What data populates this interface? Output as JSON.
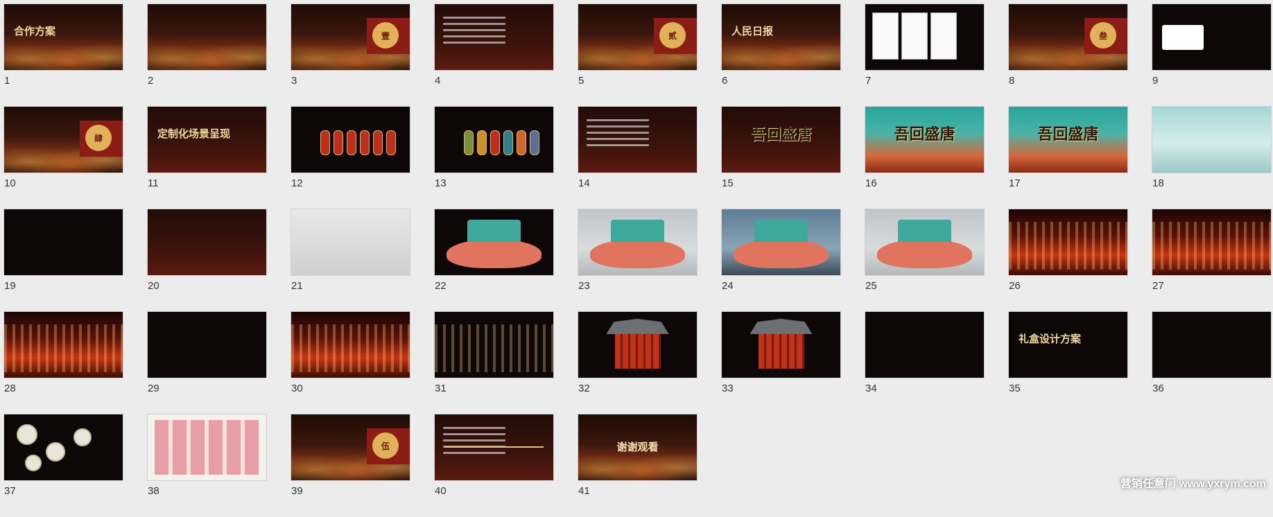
{
  "slides": [
    {
      "number": "1",
      "theme": "dark",
      "title": "合作方案"
    },
    {
      "number": "2",
      "theme": "dark",
      "title": ""
    },
    {
      "number": "3",
      "theme": "dark",
      "badge": "壹"
    },
    {
      "number": "4",
      "theme": "red",
      "title": ""
    },
    {
      "number": "5",
      "theme": "dark",
      "badge": "贰"
    },
    {
      "number": "6",
      "theme": "dark",
      "title": "人民日报"
    },
    {
      "number": "7",
      "theme": "black",
      "title": ""
    },
    {
      "number": "8",
      "theme": "dark",
      "badge": "叁"
    },
    {
      "number": "9",
      "theme": "black",
      "title": ""
    },
    {
      "number": "10",
      "theme": "dark",
      "badge": "肆"
    },
    {
      "number": "11",
      "theme": "red",
      "title": "定制化场景呈现"
    },
    {
      "number": "12",
      "theme": "black",
      "title": ""
    },
    {
      "number": "13",
      "theme": "black",
      "title": ""
    },
    {
      "number": "14",
      "theme": "red",
      "title": ""
    },
    {
      "number": "15",
      "theme": "red",
      "title": "吾回盛唐"
    },
    {
      "number": "16",
      "theme": "poster",
      "title": "吾回盛唐"
    },
    {
      "number": "17",
      "theme": "poster",
      "title": "吾回盛唐"
    },
    {
      "number": "18",
      "theme": "teal",
      "title": ""
    },
    {
      "number": "19",
      "theme": "black",
      "title": ""
    },
    {
      "number": "20",
      "theme": "red",
      "title": ""
    },
    {
      "number": "21",
      "theme": "light",
      "title": ""
    },
    {
      "number": "22",
      "theme": "black",
      "title": ""
    },
    {
      "number": "23",
      "theme": "stage",
      "title": ""
    },
    {
      "number": "24",
      "theme": "sky",
      "title": ""
    },
    {
      "number": "25",
      "theme": "stage",
      "title": ""
    },
    {
      "number": "26",
      "theme": "lantern",
      "title": ""
    },
    {
      "number": "27",
      "theme": "lantern",
      "title": ""
    },
    {
      "number": "28",
      "theme": "lantern",
      "title": ""
    },
    {
      "number": "29",
      "theme": "black",
      "title": ""
    },
    {
      "number": "30",
      "theme": "lantern",
      "title": ""
    },
    {
      "number": "31",
      "theme": "black",
      "title": ""
    },
    {
      "number": "32",
      "theme": "black",
      "title": ""
    },
    {
      "number": "33",
      "theme": "black",
      "title": ""
    },
    {
      "number": "34",
      "theme": "black",
      "title": ""
    },
    {
      "number": "35",
      "theme": "black",
      "title": "礼盒设计方案"
    },
    {
      "number": "36",
      "theme": "black",
      "title": ""
    },
    {
      "number": "37",
      "theme": "black",
      "title": ""
    },
    {
      "number": "38",
      "theme": "white",
      "title": ""
    },
    {
      "number": "39",
      "theme": "dark",
      "badge": "伍"
    },
    {
      "number": "40",
      "theme": "red",
      "title": ""
    },
    {
      "number": "41",
      "theme": "dark",
      "title": "谢谢观看"
    }
  ],
  "watermark": "营销任意门 www.yxrym.com"
}
